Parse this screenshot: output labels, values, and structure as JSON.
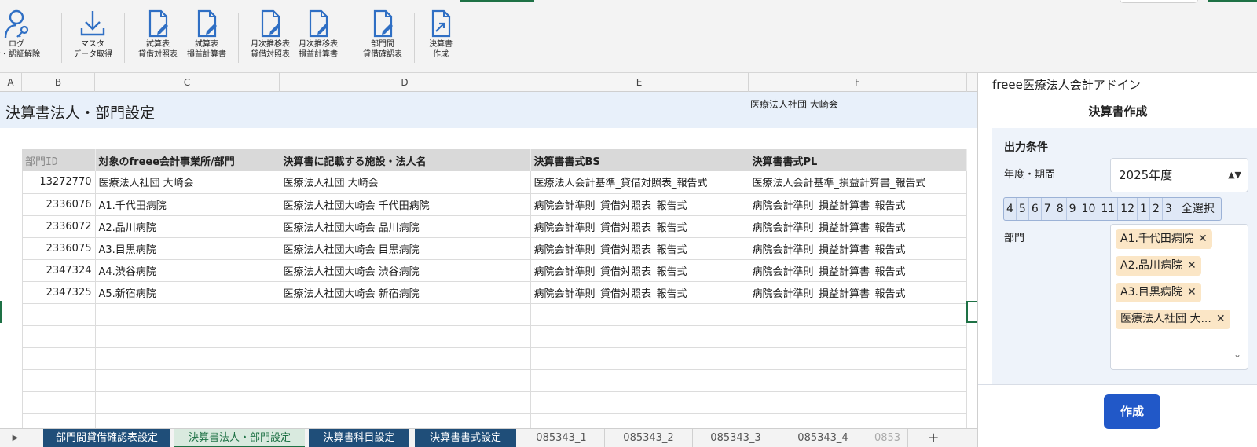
{
  "ribbon": {
    "buttons": [
      {
        "line1": "ログ",
        "line2": "ン・認証解除",
        "icon": "user-key-icon"
      },
      {
        "line1": "マスタ",
        "line2": "データ取得",
        "icon": "download-icon"
      },
      {
        "line1": "試算表",
        "line2": "貸借対照表",
        "icon": "document-edit-icon"
      },
      {
        "line1": "試算表",
        "line2": "損益計算書",
        "icon": "document-edit-icon"
      },
      {
        "line1": "月次推移表",
        "line2": "貸借対照表",
        "icon": "document-edit-icon"
      },
      {
        "line1": "月次推移表",
        "line2": "損益計算書",
        "icon": "document-edit-icon"
      },
      {
        "line1": "部門間",
        "line2": "貸借確認表",
        "icon": "document-edit-icon"
      },
      {
        "line1": "決算書",
        "line2": "作成",
        "icon": "document-export-icon"
      }
    ]
  },
  "sheet": {
    "columns": [
      "A",
      "B",
      "C",
      "D",
      "E",
      "F"
    ],
    "title": "決算書法人・部門設定",
    "organization": "医療法人社団 大崎会",
    "table": {
      "headers": [
        "部門ID",
        "対象のfreee会計事業所/部門",
        "決算書に記載する施設・法人名",
        "決算書書式BS",
        "決算書書式PL"
      ],
      "rows": [
        [
          "13272770",
          "医療法人社団 大崎会",
          "医療法人社団 大崎会",
          "医療法人会計基準_貸借対照表_報告式",
          "医療法人会計基準_損益計算書_報告式"
        ],
        [
          "2336076",
          "A1.千代田病院",
          "医療法人社団大崎会 千代田病院",
          "病院会計準則_貸借対照表_報告式",
          "病院会計準則_損益計算書_報告式"
        ],
        [
          "2336072",
          "A2.品川病院",
          "医療法人社団大崎会 品川病院",
          "病院会計準則_貸借対照表_報告式",
          "病院会計準則_損益計算書_報告式"
        ],
        [
          "2336075",
          "A3.目黒病院",
          "医療法人社団大崎会 目黒病院",
          "病院会計準則_貸借対照表_報告式",
          "病院会計準則_損益計算書_報告式"
        ],
        [
          "2347324",
          "A4.渋谷病院",
          "医療法人社団大崎会 渋谷病院",
          "病院会計準則_貸借対照表_報告式",
          "病院会計準則_損益計算書_報告式"
        ],
        [
          "2347325",
          "A5.新宿病院",
          "医療法人社団大崎会 新宿病院",
          "病院会計準則_貸借対照表_報告式",
          "病院会計準則_損益計算書_報告式"
        ]
      ]
    }
  },
  "tabs": [
    {
      "label": "部門間貸借確認表設定",
      "style": "dark"
    },
    {
      "label": "決算書法人・部門設定",
      "style": "active"
    },
    {
      "label": "決算書科目設定",
      "style": "dark"
    },
    {
      "label": "決算書書式設定",
      "style": "dark"
    },
    {
      "label": "085343_1",
      "style": "plain"
    },
    {
      "label": "085343_2",
      "style": "plain"
    },
    {
      "label": "085343_3",
      "style": "plain"
    },
    {
      "label": "085343_4",
      "style": "plain"
    },
    {
      "label": "0853",
      "style": "plain"
    }
  ],
  "tab_add": "+",
  "panel": {
    "app_title": "freee医療法人会計アドイン",
    "header": "決算書作成",
    "section": "出力条件",
    "period_label": "年度・期間",
    "period_value": "2025年度",
    "months": [
      "4",
      "5",
      "6",
      "7",
      "8",
      "9",
      "10",
      "11",
      "12",
      "1",
      "2",
      "3"
    ],
    "select_all": "全選択",
    "dept_label": "部門",
    "departments": [
      "A1.千代田病院",
      "A2.品川病院",
      "A3.目黒病院",
      "医療法人社団 大..."
    ],
    "create_button": "作成"
  },
  "colors": {
    "accent_green": "#1e7145",
    "tab_dark": "#1f4e79",
    "button_blue": "#2158c8",
    "chip": "#fbe6c6"
  }
}
